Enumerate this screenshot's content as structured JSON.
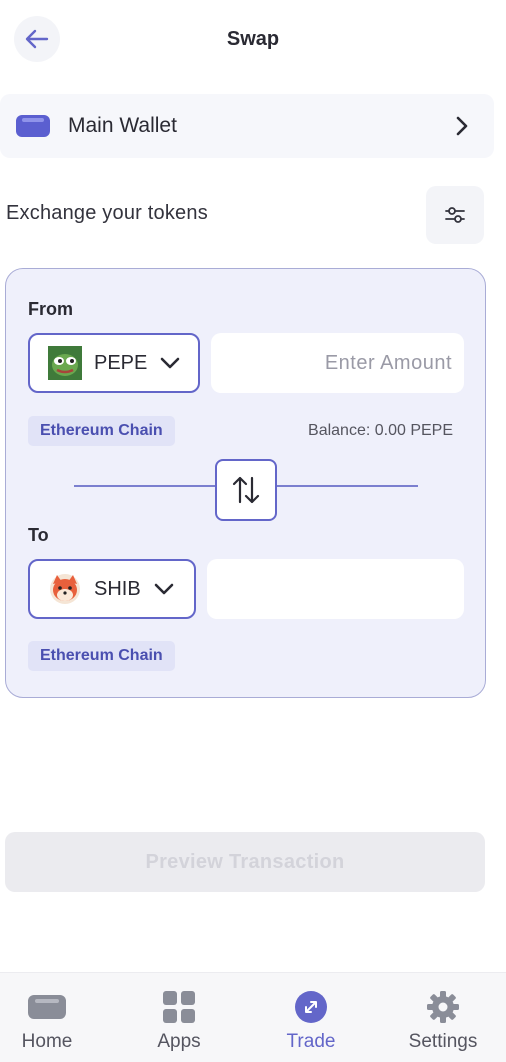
{
  "header": {
    "title": "Swap"
  },
  "wallet": {
    "name": "Main Wallet"
  },
  "exchange": {
    "label": "Exchange your tokens"
  },
  "from": {
    "label": "From",
    "token_symbol": "PEPE",
    "amount_placeholder": "Enter Amount",
    "chain": "Ethereum Chain",
    "balance": "Balance: 0.00 PEPE"
  },
  "to": {
    "label": "To",
    "token_symbol": "SHIB",
    "chain": "Ethereum Chain"
  },
  "preview_button": {
    "label": "Preview Transaction"
  },
  "nav": {
    "items": [
      {
        "label": "Home",
        "icon": "wallet-icon"
      },
      {
        "label": "Apps",
        "icon": "grid-icon"
      },
      {
        "label": "Trade",
        "icon": "trade-arrows-icon",
        "active": true
      },
      {
        "label": "Settings",
        "icon": "gear-icon"
      }
    ]
  },
  "colors": {
    "accent": "#6366c9",
    "card_background": "#eff0fb",
    "disabled_button": "#ebebef"
  }
}
